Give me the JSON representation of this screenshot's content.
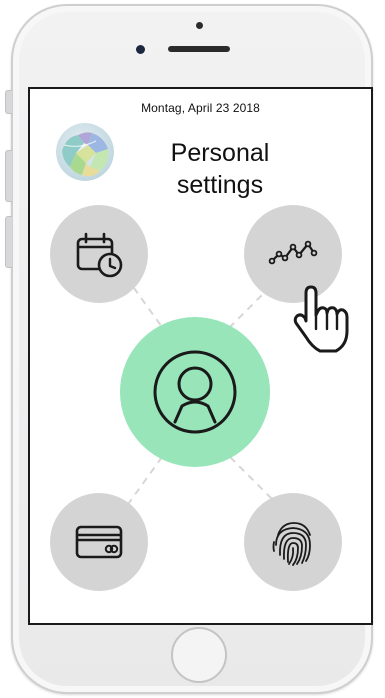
{
  "header": {
    "date": "Montag, April 23 2018",
    "title_line1": "Personal",
    "title_line2": "settings"
  },
  "colors": {
    "center_button": "#98e5ba",
    "option_button": "#d4d4d4",
    "icon_stroke": "#1a1a1a"
  },
  "icons": {
    "top_left": "calendar-clock-icon",
    "top_right": "trend-chart-icon",
    "center": "user-profile-icon",
    "bottom_left": "credit-card-icon",
    "bottom_right": "fingerprint-icon",
    "cursor": "hand-pointer-icon"
  }
}
